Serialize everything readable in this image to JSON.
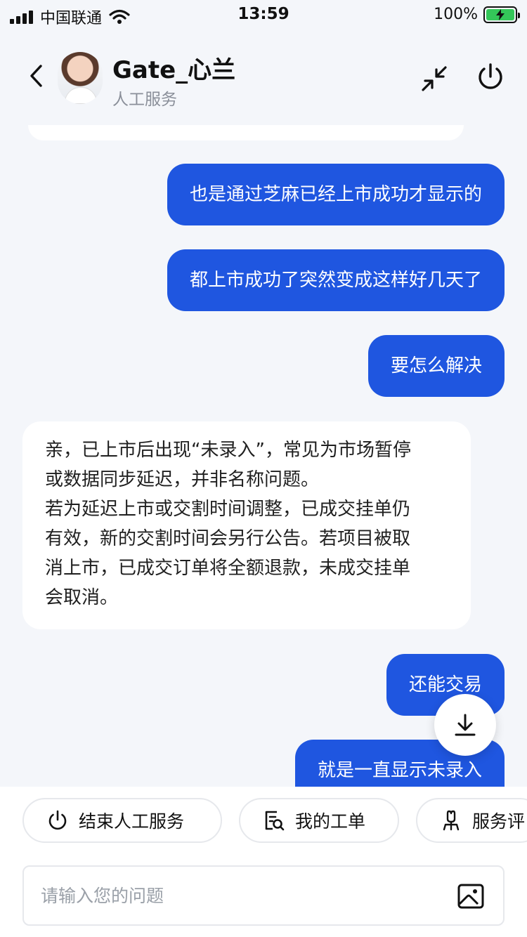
{
  "status_bar": {
    "carrier": "中国联通",
    "time": "13:59",
    "battery": "100%"
  },
  "header": {
    "agent_name": "Gate_心兰",
    "agent_subtitle": "人工服务"
  },
  "messages": [
    {
      "from": "user",
      "text": "也是通过芝麻已经上市成功才显示的"
    },
    {
      "from": "user",
      "text": "都上市成功了突然变成这样好几天了"
    },
    {
      "from": "user",
      "text": "要怎么解决"
    },
    {
      "from": "agent",
      "lines": [
        "亲，已上市后出现“未录入”，常见为市场暂停",
        "或数据同步延迟，并非名称问题。",
        "若为延迟上市或交割时间调整，已成交挂单仍",
        "有效，新的交割时间会另行公告。若项目被取",
        "消上市，已成交订单将全额退款，未成交挂单",
        "会取消。"
      ]
    },
    {
      "from": "user",
      "text": "还能交易"
    },
    {
      "from": "user",
      "text": "就是一直显示未录入"
    }
  ],
  "quick_actions": [
    {
      "label": "结束人工服务",
      "icon": "power-icon"
    },
    {
      "label": "我的工单",
      "icon": "ticket-search-icon"
    },
    {
      "label": "服务评",
      "icon": "rating-icon"
    }
  ],
  "input": {
    "placeholder": "请输入您的问题",
    "value": ""
  },
  "colors": {
    "accent": "#1f56e0",
    "background": "#f4f6fa",
    "battery_green": "#34c759"
  }
}
